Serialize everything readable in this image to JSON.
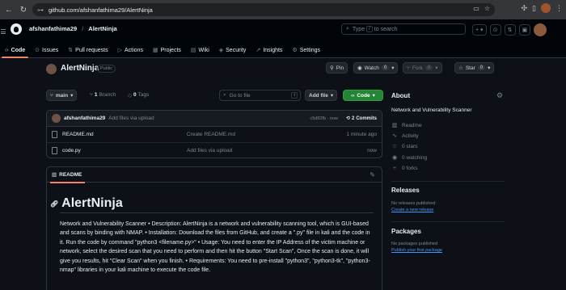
{
  "browser": {
    "url": "github.com/afshanfathima29/AlertNinja"
  },
  "header": {
    "owner": "afshanfathima29",
    "separator": "/",
    "repo": "AlertNinja",
    "search": {
      "prefix": "Type",
      "key": "/",
      "suffix": "to search"
    },
    "new_label": "+"
  },
  "tabs": [
    {
      "label": "Code",
      "icon": "code-icon"
    },
    {
      "label": "Issues",
      "icon": "issues-icon"
    },
    {
      "label": "Pull requests",
      "icon": "pull-request-icon"
    },
    {
      "label": "Actions",
      "icon": "actions-icon"
    },
    {
      "label": "Projects",
      "icon": "projects-icon"
    },
    {
      "label": "Wiki",
      "icon": "wiki-icon"
    },
    {
      "label": "Security",
      "icon": "shield-icon"
    },
    {
      "label": "Insights",
      "icon": "graph-icon"
    },
    {
      "label": "Settings",
      "icon": "gear-icon"
    }
  ],
  "repo": {
    "name": "AlertNinja",
    "visibility": "Public",
    "pin_label": "Pin",
    "watch_label": "Watch",
    "watch_count": "0",
    "fork_label": "Fork",
    "fork_count": "0",
    "star_label": "Star",
    "star_count": "0"
  },
  "toolbar": {
    "branch": "main",
    "branch_count": "1",
    "branch_label": "Branch",
    "tag_count": "0",
    "tag_label": "Tags",
    "goto_placeholder": "Go to file",
    "goto_key": "t",
    "add_file": "Add file",
    "code_button": "Code"
  },
  "commit": {
    "author": "afshanfathima29",
    "message": "Add files via upload",
    "hash": "c5d82fb · now",
    "commits_count": "2",
    "commits_label": "Commits"
  },
  "files": [
    {
      "name": "README.md",
      "message": "Create README.md",
      "time": "1 minute ago"
    },
    {
      "name": "code.py",
      "message": "Add files via upload",
      "time": "now"
    }
  ],
  "readme": {
    "tab_label": "README",
    "title": "AlertNinja",
    "body": "Network and Vulnerability Scanner • Description: AlertNinja is a network and vulnerability scanning tool, which is GUI-based and scans by binding with NMAP. • Installation: Download the files from GitHub, and create a \".py\" file in kali and the code in it. Run the code by command \"python3 <filename.py>\" • Usage: You need to enter the IP Address of the victim machine or network, select the desired scan that you need to perform and then hit the button \"Start Scan\", Once the scan is done, it will give you results, hit \"Clear Scan\" when you finish. • Requirements: You need to pre-install \"python3\", \"python3-tk\", \"python3-nmap\" libraries in your kali machine to execute the code file."
  },
  "about": {
    "heading": "About",
    "description": "Network and Vulnerability Scanner",
    "items": [
      {
        "label": "Readme",
        "icon": "book-icon"
      },
      {
        "label": "Activity",
        "icon": "pulse-icon"
      },
      {
        "label": "0 stars",
        "icon": "star-icon"
      },
      {
        "label": "0 watching",
        "icon": "eye-icon"
      },
      {
        "label": "0 forks",
        "icon": "fork-icon"
      }
    ]
  },
  "releases": {
    "heading": "Releases",
    "empty": "No releases published",
    "link": "Create a new release"
  },
  "packages": {
    "heading": "Packages",
    "empty": "No packages published",
    "link": "Publish your first package"
  },
  "colors": {
    "background": "#0d1117",
    "header": "#010409",
    "accent_tab": "#f78166",
    "green_button": "#238636",
    "link": "#4493f8",
    "muted": "#7d8590"
  }
}
